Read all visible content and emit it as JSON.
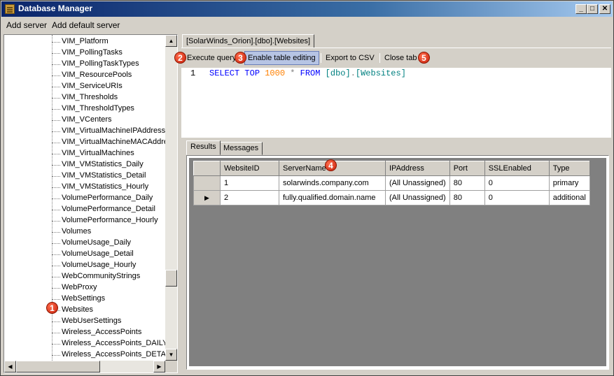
{
  "window": {
    "title": "Database Manager",
    "minimize": "_",
    "maximize": "□",
    "close": "✕"
  },
  "menu": {
    "add_server": "Add server",
    "add_default_server": "Add default server"
  },
  "tree": {
    "items": [
      "VIM_Platform",
      "VIM_PollingTasks",
      "VIM_PollingTaskTypes",
      "VIM_ResourcePools",
      "VIM_ServiceURIs",
      "VIM_Thresholds",
      "VIM_ThresholdTypes",
      "VIM_VCenters",
      "VIM_VirtualMachineIPAddresse",
      "VIM_VirtualMachineMACAddre",
      "VIM_VirtualMachines",
      "VIM_VMStatistics_Daily",
      "VIM_VMStatistics_Detail",
      "VIM_VMStatistics_Hourly",
      "VolumePerformance_Daily",
      "VolumePerformance_Detail",
      "VolumePerformance_Hourly",
      "Volumes",
      "VolumeUsage_Daily",
      "VolumeUsage_Detail",
      "VolumeUsage_Hourly",
      "WebCommunityStrings",
      "WebProxy",
      "WebSettings",
      "Websites",
      "WebUserSettings",
      "Wireless_AccessPoints",
      "Wireless_AccessPoints_DAILY",
      "Wireless_AccessPoints_DETAI"
    ]
  },
  "doc_tab": "[SolarWinds_Orion].[dbo].[Websites]",
  "toolbar": {
    "execute": "Execute query",
    "enable_editing": "Enable table editing",
    "export_csv": "Export to CSV",
    "close_tab": "Close tab"
  },
  "editor": {
    "line_number": "1",
    "sql": {
      "select": "SELECT",
      "top": "TOP",
      "count": "1000",
      "star": "*",
      "from": "FROM",
      "schema": "[dbo]",
      "dot": ".",
      "table": "[Websites]"
    }
  },
  "result_tabs": {
    "results": "Results",
    "messages": "Messages"
  },
  "grid": {
    "columns": [
      "WebsiteID",
      "ServerName",
      "IPAddress",
      "Port",
      "SSLEnabled",
      "Type"
    ],
    "rows": [
      [
        "1",
        "solarwinds.company.com",
        "(All Unassigned)",
        "80",
        "0",
        "primary"
      ],
      [
        "2",
        "fully.qualified.domain.name",
        "(All Unassigned)",
        "80",
        "0",
        "additional"
      ]
    ],
    "current_row_indicator": "▶"
  },
  "markers": {
    "m1": "1",
    "m2": "2",
    "m3": "3",
    "m4": "4",
    "m5": "5"
  },
  "colors": {
    "marker": "#d0280f",
    "title_bar": "#0a246a",
    "grid_background": "#808080"
  }
}
